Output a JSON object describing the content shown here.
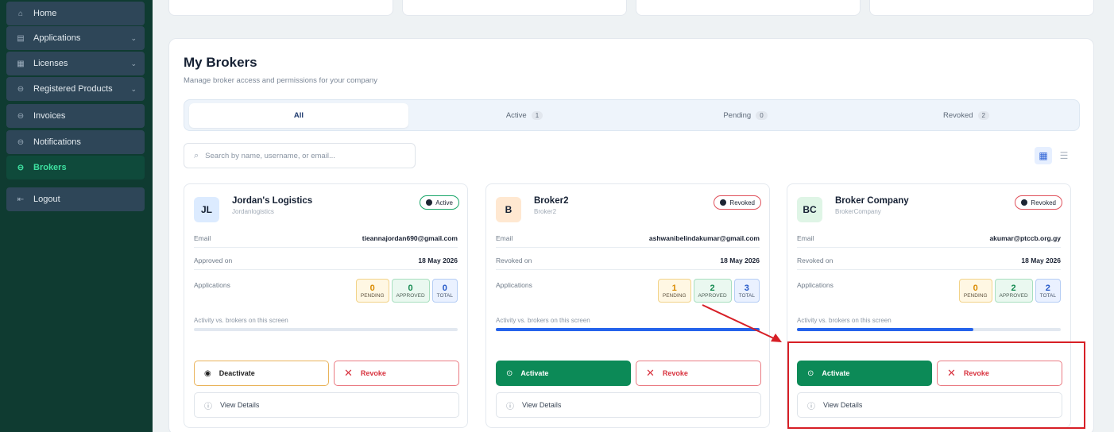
{
  "sidebar": {
    "items": [
      {
        "label": "Home",
        "icon": "home-icon",
        "chevron": false,
        "active": false
      },
      {
        "label": "Applications",
        "icon": "document-icon",
        "chevron": true,
        "active": false
      },
      {
        "label": "Licenses",
        "icon": "license-icon",
        "chevron": true,
        "active": false
      },
      {
        "label": "Registered Products",
        "icon": "product-icon",
        "chevron": true,
        "active": false
      },
      {
        "label": "Invoices",
        "icon": "invoice-icon",
        "chevron": false,
        "active": false
      },
      {
        "label": "Notifications",
        "icon": "bell-icon",
        "chevron": false,
        "active": false
      },
      {
        "label": "Brokers",
        "icon": "brokers-icon",
        "chevron": false,
        "active": true
      }
    ],
    "logout_label": "Logout"
  },
  "main": {
    "title": "My Brokers",
    "subtitle": "Manage broker access and permissions for your company",
    "tabs": [
      {
        "label": "All",
        "count": null,
        "selected": true
      },
      {
        "label": "Active",
        "count": "1",
        "selected": false
      },
      {
        "label": "Pending",
        "count": "0",
        "selected": false
      },
      {
        "label": "Revoked",
        "count": "2",
        "selected": false
      }
    ],
    "search": {
      "placeholder": "Search by name, username, or email..."
    }
  },
  "cards": [
    {
      "initials": "JL",
      "avatar_color": "#dcebff",
      "name": "Jordan's Logistics",
      "username": "Jordanlogistics",
      "status": "Active",
      "email_label": "Email",
      "email": "tieannajordan690@gmail.com",
      "date_label": "Approved on",
      "date": "18 May 2026",
      "applications_label": "Applications",
      "pending": "0",
      "approved": "0",
      "total": "0",
      "pending_label": "PENDING",
      "approved_label": "APPROVED",
      "total_label": "TOTAL",
      "activity_label": "Activity vs. brokers on this screen",
      "activity_fraction": 0,
      "primary_action": "Deactivate",
      "revoke_label": "Revoke",
      "details_label": "View Details"
    },
    {
      "initials": "B",
      "avatar_color": "#ffe8d1",
      "name": "Broker2",
      "username": "Broker2",
      "status": "Revoked",
      "email_label": "Email",
      "email": "ashwanibelindakumar@gmail.com",
      "date_label": "Revoked on",
      "date": "18 May 2026",
      "applications_label": "Applications",
      "pending": "1",
      "approved": "2",
      "total": "3",
      "pending_label": "PENDING",
      "approved_label": "APPROVED",
      "total_label": "TOTAL",
      "activity_label": "Activity vs. brokers on this screen",
      "activity_fraction": 1,
      "primary_action": "Activate",
      "revoke_label": "Revoke",
      "details_label": "View Details"
    },
    {
      "initials": "BC",
      "avatar_color": "#dff5e6",
      "name": "Broker Company",
      "username": "BrokerCompany",
      "status": "Revoked",
      "email_label": "Email",
      "email": "akumar@ptccb.org.gy",
      "date_label": "Revoked on",
      "date": "18 May 2026",
      "applications_label": "Applications",
      "pending": "0",
      "approved": "2",
      "total": "2",
      "pending_label": "PENDING",
      "approved_label": "APPROVED",
      "total_label": "TOTAL",
      "activity_label": "Activity vs. brokers on this screen",
      "activity_fraction": 0.67,
      "primary_action": "Activate",
      "revoke_label": "Revoke",
      "details_label": "View Details"
    }
  ],
  "colors": {
    "sidebar_bg": "#0f3b31",
    "accent_green": "#0c8a57",
    "revoke_red": "#d8333f",
    "progress_blue": "#2563eb",
    "annotation_red": "#d71f26"
  }
}
